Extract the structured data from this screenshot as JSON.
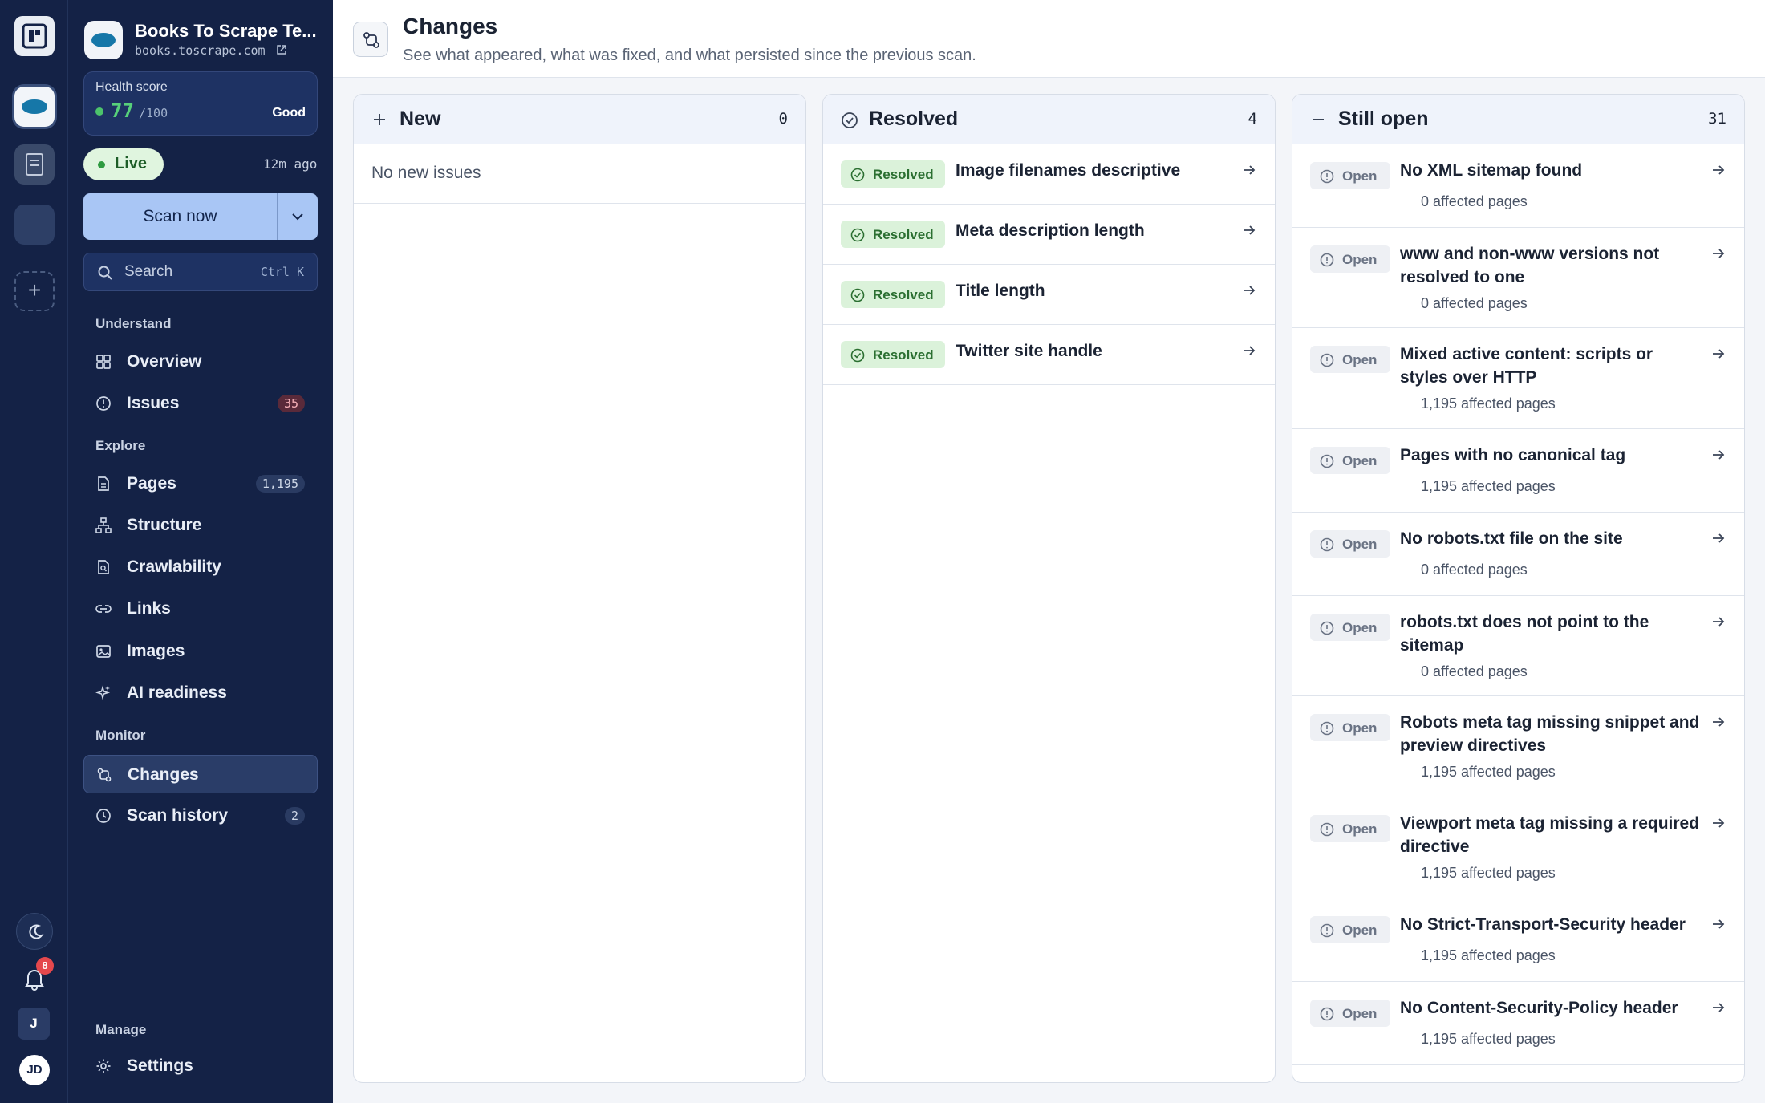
{
  "project": {
    "name": "Books To Scrape Te...",
    "url": "books.toscrape.com"
  },
  "health": {
    "label": "Health score",
    "value": "77",
    "max": "/100",
    "rating": "Good"
  },
  "status": {
    "live": "Live",
    "ago": "12m ago"
  },
  "scan": {
    "label": "Scan now"
  },
  "search": {
    "placeholder": "Search",
    "shortcut": "Ctrl K"
  },
  "nav": {
    "understand_label": "Understand",
    "overview": "Overview",
    "issues": "Issues",
    "issues_count": "35",
    "explore_label": "Explore",
    "pages": "Pages",
    "pages_count": "1,195",
    "structure": "Structure",
    "crawlability": "Crawlability",
    "links": "Links",
    "images": "Images",
    "ai_readiness": "AI readiness",
    "monitor_label": "Monitor",
    "changes": "Changes",
    "scan_history": "Scan history",
    "scan_history_count": "2",
    "manage_label": "Manage",
    "settings": "Settings"
  },
  "rail": {
    "notifications": "8",
    "workspace": "J",
    "user": "JD"
  },
  "header": {
    "title": "Changes",
    "subtitle": "See what appeared, what was fixed, and what persisted since the previous scan."
  },
  "columns": {
    "new": {
      "title": "New",
      "count": "0",
      "empty": "No new issues"
    },
    "resolved": {
      "title": "Resolved",
      "count": "4",
      "badge": "Resolved",
      "items": [
        {
          "title": "Image filenames descriptive"
        },
        {
          "title": "Meta description length"
        },
        {
          "title": "Title length"
        },
        {
          "title": "Twitter site handle"
        }
      ]
    },
    "still_open": {
      "title": "Still open",
      "count": "31",
      "badge": "Open",
      "items": [
        {
          "title": "No XML sitemap found",
          "affected": "0 affected pages"
        },
        {
          "title": "www and non-www versions not resolved to one",
          "affected": "0 affected pages"
        },
        {
          "title": "Mixed active content: scripts or styles over HTTP",
          "affected": "1,195 affected pages"
        },
        {
          "title": "Pages with no canonical tag",
          "affected": "1,195 affected pages"
        },
        {
          "title": "No robots.txt file on the site",
          "affected": "0 affected pages"
        },
        {
          "title": "robots.txt does not point to the sitemap",
          "affected": "0 affected pages"
        },
        {
          "title": "Robots meta tag missing snippet and preview directives",
          "affected": "1,195 affected pages"
        },
        {
          "title": "Viewport meta tag missing a required directive",
          "affected": "1,195 affected pages"
        },
        {
          "title": "No Strict-Transport-Security header",
          "affected": "1,195 affected pages"
        },
        {
          "title": "No Content-Security-Policy header",
          "affected": "1,195 affected pages"
        }
      ]
    }
  },
  "colors": {
    "accent": "#a9c6f5",
    "sidebar": "#142246",
    "resolved": "#2b6f31",
    "score": "#57d07a"
  }
}
